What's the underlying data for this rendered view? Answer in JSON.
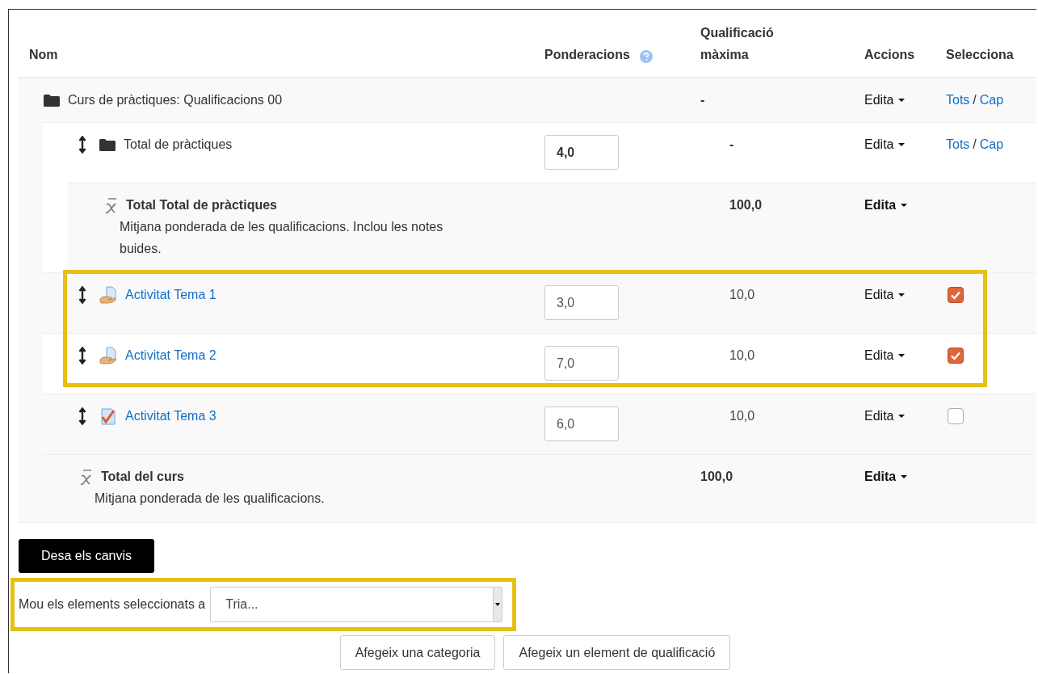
{
  "columns": [
    {
      "label": "Nom"
    },
    {
      "label": "Ponderacions",
      "help": true
    },
    {
      "label": "Qualificació màxima"
    },
    {
      "label": "Accions"
    },
    {
      "label": "Selecciona"
    }
  ],
  "rows": [
    {
      "kind": "course-category",
      "name": "Curs de pràctiques: Qualificacions 00",
      "max": "-",
      "action": "Edita",
      "select_all": "Tots",
      "separator": "/",
      "select_none": "Cap",
      "children": [
        {
          "kind": "category",
          "movable": true,
          "name": "Total de pràctiques",
          "weight": "4,0",
          "max": "-",
          "action": "Edita",
          "select_all": "Tots",
          "separator": "/",
          "select_none": "Cap",
          "children": [
            {
              "kind": "category-total",
              "name": "Total Total de pràctiques",
              "description": "Mitjana ponderada de les qualificacions. Inclou les notes buides.",
              "max": "100,0",
              "action": "Edita"
            }
          ]
        },
        {
          "kind": "assignment",
          "movable": true,
          "name": "Activitat Tema 1",
          "weight": "3,0",
          "max": "10,0",
          "action": "Edita",
          "checked": true,
          "highlighted": true
        },
        {
          "kind": "assignment",
          "movable": true,
          "name": "Activitat Tema 2",
          "weight": "7,0",
          "max": "10,0",
          "action": "Edita",
          "checked": true,
          "highlighted": true
        },
        {
          "kind": "quiz",
          "movable": true,
          "name": "Activitat Tema 3",
          "weight": "6,0",
          "max": "10,0",
          "action": "Edita",
          "checked": false
        },
        {
          "kind": "course-total",
          "name": "Total del curs",
          "description": "Mitjana ponderada de les qualificacions.",
          "max": "100,0",
          "action": "Edita"
        }
      ]
    }
  ],
  "save_button": "Desa els canvis",
  "move": {
    "label": "Mou els elements seleccionats a",
    "value": "Tria...",
    "highlighted": true
  },
  "buttons": [
    "Afegeix una categoria",
    "Afegeix un element de qualificació"
  ]
}
